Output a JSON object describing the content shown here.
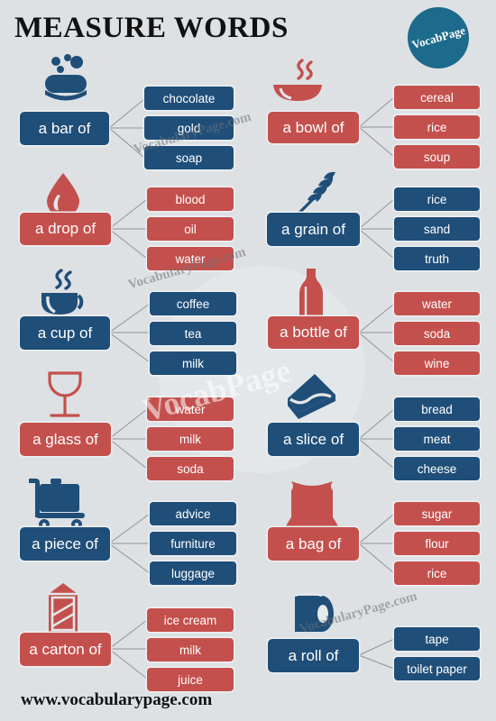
{
  "header": {
    "title": "MEASURE WORDS",
    "logo_text": "VocabPage"
  },
  "footer": {
    "url": "www.vocabularypage.com"
  },
  "watermarks": {
    "w1": "VocabularyPage.com",
    "w2": "VocabularyPage.com",
    "w3": "VocabPage",
    "w4": "VocabularyPage.com"
  },
  "colors": {
    "background": "#dde1e4",
    "blue": "#1f4e79",
    "red": "#c4504d",
    "logo_teal": "#1c6a8c",
    "text_dark": "#111111"
  },
  "groups": [
    {
      "id": "a-bar-of",
      "measure": "a bar of",
      "color": "blue",
      "icon": "soap-bar-icon",
      "items": [
        "chocolate",
        "gold",
        "soap"
      ]
    },
    {
      "id": "a-bowl-of",
      "measure": "a bowl of",
      "color": "red",
      "icon": "soup-bowl-icon",
      "items": [
        "cereal",
        "rice",
        "soup"
      ]
    },
    {
      "id": "a-drop-of",
      "measure": "a drop of",
      "color": "red",
      "icon": "water-drop-icon",
      "items": [
        "blood",
        "oil",
        "water"
      ]
    },
    {
      "id": "a-grain-of",
      "measure": "a grain of",
      "color": "blue",
      "icon": "wheat-grain-icon",
      "items": [
        "rice",
        "sand",
        "truth"
      ]
    },
    {
      "id": "a-cup-of",
      "measure": "a cup of",
      "color": "blue",
      "icon": "coffee-cup-icon",
      "items": [
        "coffee",
        "tea",
        "milk"
      ]
    },
    {
      "id": "a-bottle-of",
      "measure": "a bottle of",
      "color": "red",
      "icon": "bottle-icon",
      "items": [
        "water",
        "soda",
        "wine"
      ]
    },
    {
      "id": "a-glass-of",
      "measure": "a glass of",
      "color": "red",
      "icon": "wine-glass-icon",
      "items": [
        "water",
        "milk",
        "soda"
      ]
    },
    {
      "id": "a-slice-of",
      "measure": "a slice of",
      "color": "blue",
      "icon": "cake-slice-icon",
      "items": [
        "bread",
        "meat",
        "cheese"
      ]
    },
    {
      "id": "a-piece-of",
      "measure": "a piece of",
      "color": "blue",
      "icon": "luggage-cart-icon",
      "items": [
        "advice",
        "furniture",
        "luggage"
      ]
    },
    {
      "id": "a-bag-of",
      "measure": "a bag of",
      "color": "red",
      "icon": "sack-bag-icon",
      "items": [
        "sugar",
        "flour",
        "rice"
      ]
    },
    {
      "id": "a-carton-of",
      "measure": "a carton of",
      "color": "red",
      "icon": "milk-carton-icon",
      "items": [
        "ice cream",
        "milk",
        "juice"
      ]
    },
    {
      "id": "a-roll-of",
      "measure": "a roll of",
      "color": "blue",
      "icon": "paper-roll-icon",
      "items": [
        "tape",
        "toilet paper"
      ]
    }
  ]
}
